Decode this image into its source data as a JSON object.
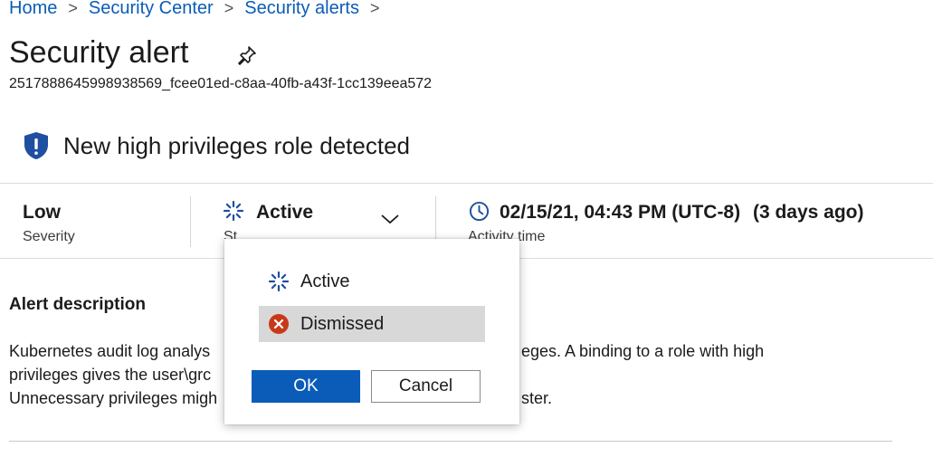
{
  "breadcrumb": {
    "items": [
      "Home",
      "Security Center",
      "Security alerts"
    ],
    "separator": ">"
  },
  "page": {
    "title": "Security alert",
    "alert_id": "2517888645998938569_fcee01ed-c8aa-40fb-a43f-1cc139eea572"
  },
  "alert": {
    "name": "New high privileges role detected",
    "icon": "shield-exclamation-icon"
  },
  "info": {
    "severity_value": "Low",
    "severity_label": "Severity",
    "status_value": "Active",
    "status_label": "Status",
    "status_label_visible": "St",
    "activity_value": "02/15/21, 04:43 PM (UTC-8)",
    "activity_relative": "(3 days ago)",
    "activity_label": "Activity time"
  },
  "description": {
    "title": "Alert description",
    "lines": [
      "Kubernetes audit log analys",
      "privileges gives the user\\grc",
      "Unnecessary privileges migh"
    ],
    "lines_right": [
      "eges. A binding to a role with high",
      "",
      "ster."
    ]
  },
  "status_popup": {
    "options": [
      {
        "label": "Active",
        "icon": "spinner-icon",
        "selected": false
      },
      {
        "label": "Dismissed",
        "icon": "dismiss-circle-icon",
        "selected": true
      }
    ],
    "ok_label": "OK",
    "cancel_label": "Cancel"
  },
  "colors": {
    "link": "#0a5cb8",
    "primary_button": "#0a5cb8",
    "shield": "#1f4fa0",
    "dismissed_icon": "#c8391a",
    "selected_option_bg": "#d8d8d8"
  }
}
